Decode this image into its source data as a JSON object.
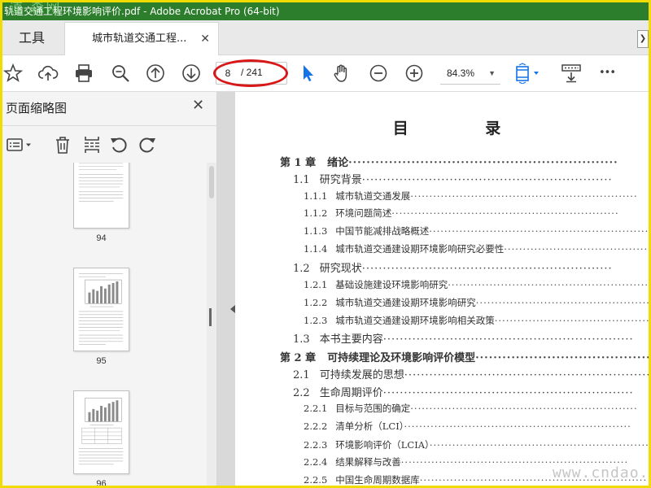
{
  "window": {
    "title": "轨道交通工程环境影响评价.pdf - Adobe Acrobat Pro (64-bit)",
    "corner_watermark": "道 森网"
  },
  "tabs": {
    "tools_label": "工具",
    "doc_label": "城市轨道交通工程...",
    "close_glyph": "✕",
    "scroll_glyph": "❯"
  },
  "toolbar": {
    "icons": [
      "star-icon",
      "cloud-upload-icon",
      "print-icon",
      "zoom-out-search-icon",
      "page-up-icon",
      "page-down-icon",
      "select-cursor-icon",
      "hand-icon",
      "minus-circle-icon",
      "plus-circle-icon",
      "fit-page-icon",
      "keyboard-icon",
      "more-icon"
    ],
    "page_current": "8",
    "page_total": "/ 241",
    "zoom_value": "84.3%",
    "zoom_arrow": "▼",
    "more_label": "•••"
  },
  "sidebar": {
    "title": "页面缩略图",
    "close_glyph": "✕",
    "thumbnails": [
      {
        "page": "94"
      },
      {
        "page": "95"
      },
      {
        "page": "96"
      }
    ]
  },
  "document": {
    "toc_title": "目  录",
    "entries": [
      {
        "level": 0,
        "number": "第 1 章",
        "text": "绪论"
      },
      {
        "level": 1,
        "number": "1.1",
        "text": "研究背景"
      },
      {
        "level": 2,
        "number": "1.1.1",
        "text": "城市轨道交通发展"
      },
      {
        "level": 2,
        "number": "1.1.2",
        "text": "环境问题简述"
      },
      {
        "level": 2,
        "number": "1.1.3",
        "text": "中国节能减排战略概述"
      },
      {
        "level": 2,
        "number": "1.1.4",
        "text": "城市轨道交通建设期环境影响研究必要性"
      },
      {
        "level": 1,
        "number": "1.2",
        "text": "研究现状"
      },
      {
        "level": 2,
        "number": "1.2.1",
        "text": "基础设施建设环境影响研究"
      },
      {
        "level": 2,
        "number": "1.2.2",
        "text": "城市轨道交通建设期环境影响研究"
      },
      {
        "level": 2,
        "number": "1.2.3",
        "text": "城市轨道交通建设期环境影响相关政策"
      },
      {
        "level": 1,
        "number": "1.3",
        "text": "本书主要内容"
      },
      {
        "level": 0,
        "number": "第 2 章",
        "text": "可持续理论及环境影响评价模型"
      },
      {
        "level": 1,
        "number": "2.1",
        "text": "可持续发展的思想"
      },
      {
        "level": 1,
        "number": "2.2",
        "text": "生命周期评价"
      },
      {
        "level": 2,
        "number": "2.2.1",
        "text": "目标与范围的确定"
      },
      {
        "level": 2,
        "number": "2.2.2",
        "text": "清单分析（LCI）"
      },
      {
        "level": 2,
        "number": "2.2.3",
        "text": "环境影响评价（LCIA）"
      },
      {
        "level": 2,
        "number": "2.2.4",
        "text": "结果解释与改善"
      },
      {
        "level": 2,
        "number": "2.2.5",
        "text": "中国生命周期数据库"
      }
    ],
    "site_watermark": "www.cndao.com"
  },
  "colors": {
    "title_bar": "#2c7d2c",
    "highlight_ring": "#d81818",
    "select_tool": "#1473e6",
    "frame": "#f0dc00"
  }
}
